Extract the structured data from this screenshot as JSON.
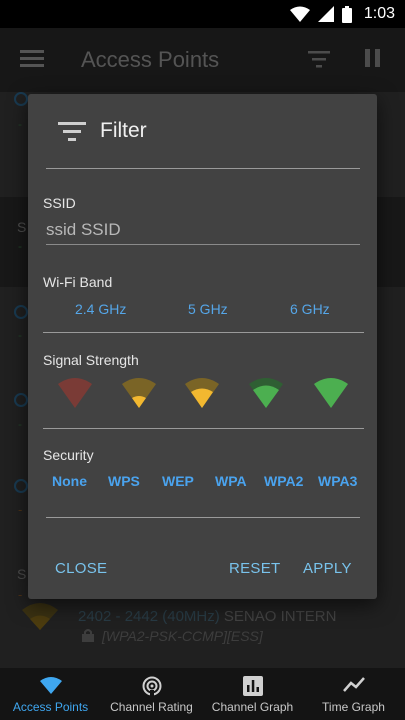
{
  "status_bar": {
    "time": "1:03"
  },
  "app_bar": {
    "title": "Access Points"
  },
  "background": {
    "entry_freq": "2402 - 2442 (40MHz)",
    "entry_ssid": "SENAO INTERN",
    "entry_security": "[WPA2-PSK-CCMP][ESS]"
  },
  "dialog": {
    "title": "Filter",
    "ssid_label": "SSID",
    "ssid_value": "ssid SSID",
    "band_label": "Wi-Fi Band",
    "bands": [
      "2.4 GHz",
      "5 GHz",
      "6 GHz"
    ],
    "signal_label": "Signal Strength",
    "signal_levels": [
      {
        "level": 0,
        "color": "#7a3b36"
      },
      {
        "level": 1,
        "color": "#f2b830"
      },
      {
        "level": 2,
        "color": "#f2b830"
      },
      {
        "level": 3,
        "color": "#4caf50"
      },
      {
        "level": 4,
        "color": "#4caf50"
      }
    ],
    "security_label": "Security",
    "security": [
      "None",
      "WPS",
      "WEP",
      "WPA",
      "WPA2",
      "WPA3"
    ],
    "close_label": "CLOSE",
    "reset_label": "RESET",
    "apply_label": "APPLY"
  },
  "bottom_nav": {
    "items": [
      {
        "label": "Access Points",
        "icon": "wifi-icon",
        "active": true
      },
      {
        "label": "Channel Rating",
        "icon": "signal-rating-icon",
        "active": false
      },
      {
        "label": "Channel Graph",
        "icon": "bar-chart-icon",
        "active": false
      },
      {
        "label": "Time Graph",
        "icon": "line-graph-icon",
        "active": false
      }
    ]
  },
  "colors": {
    "accent": "#3fa7f0",
    "dialog_bg": "#424242",
    "app_bar": "#2b2b2b"
  }
}
